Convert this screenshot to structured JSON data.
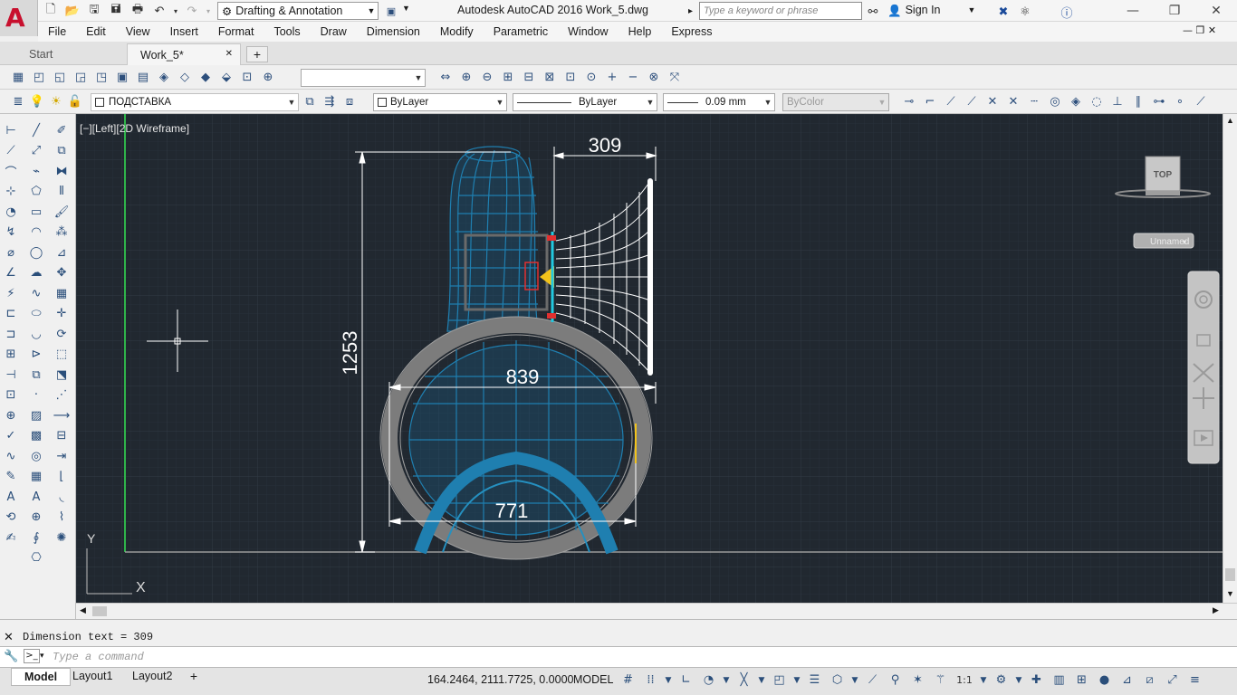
{
  "app": {
    "logo_letter": "A",
    "title": "Autodesk AutoCAD 2016    Work_5.dwg",
    "workspace": "Drafting & Annotation",
    "search_placeholder": "Type a keyword or phrase",
    "sign_in": "Sign In"
  },
  "menu": [
    "File",
    "Edit",
    "View",
    "Insert",
    "Format",
    "Tools",
    "Draw",
    "Dimension",
    "Modify",
    "Parametric",
    "Window",
    "Help",
    "Express"
  ],
  "file_tabs": {
    "start": "Start",
    "active": "Work_5*"
  },
  "properties_bar": {
    "layer": "ПОДСТАВКА",
    "color": "ByLayer",
    "linetype": "ByLayer",
    "lineweight": "0.09 mm",
    "plotstyle": "ByColor"
  },
  "viewport": {
    "label": "[−][Left][2D Wireframe]",
    "viewcube_face": "TOP",
    "ucs_name": "Unnamed",
    "ucs_y": "Y",
    "ucs_x": "X",
    "dimensions": {
      "d_top": "309",
      "d_height": "1253",
      "d_mid": "839",
      "d_bottom": "771"
    }
  },
  "command": {
    "history": "Dimension text = 309",
    "placeholder": "Type a command"
  },
  "layout_tabs": [
    "Model",
    "Layout1",
    "Layout2"
  ],
  "status": {
    "coords": "164.2464, 2111.7725, 0.0000",
    "space": "MODEL",
    "scale": "1:1"
  },
  "colors": {
    "background": "#212830",
    "grid": "#2c343e",
    "wire_blue": "#1f7fb0",
    "ring_gray": "#8a8a8a",
    "wire_white": "#ffffff",
    "y_axis": "#2fb34a",
    "accent_red": "#e03030",
    "accent_yellow": "#f2c31b"
  }
}
